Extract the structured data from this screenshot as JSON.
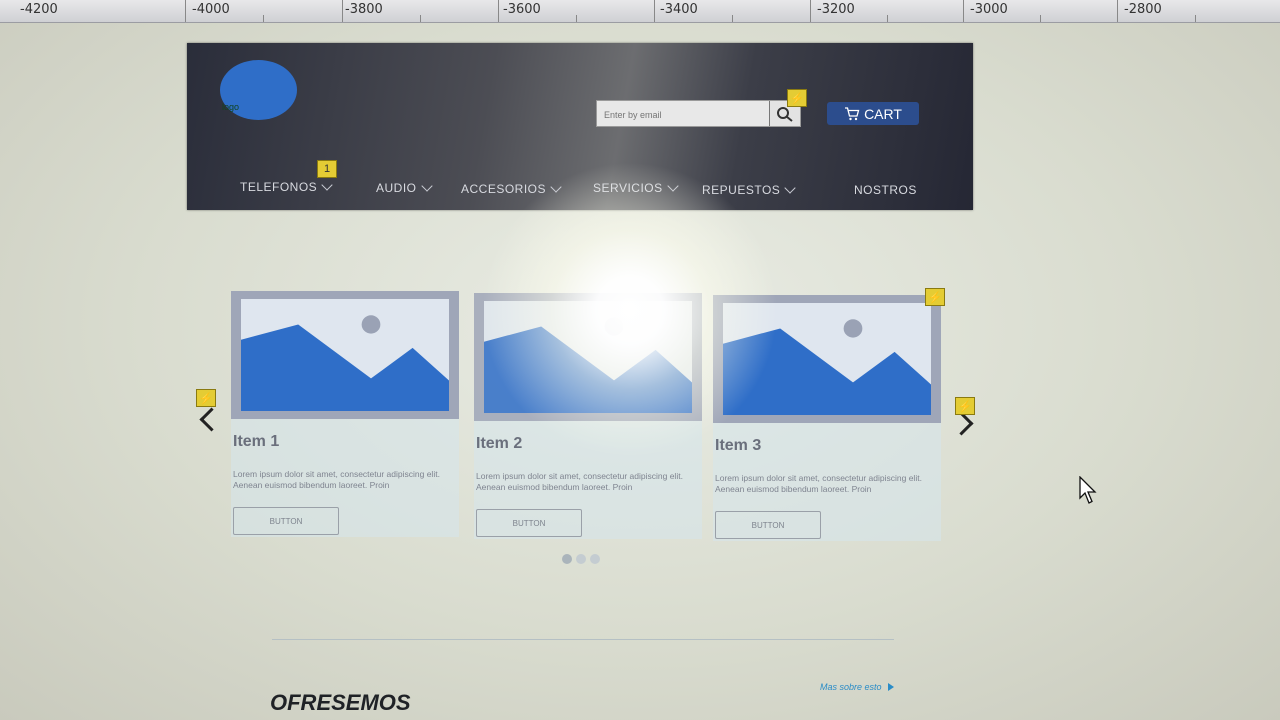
{
  "ruler": {
    "labels": [
      "-4200",
      "-4000",
      "-3800",
      "-3600",
      "-3400",
      "-3200",
      "-3000",
      "-2800"
    ]
  },
  "header": {
    "logo_text": "logo",
    "search_placeholder": "Enter by email",
    "cart_label": "CART",
    "nav": [
      {
        "label": "TELEFONOS",
        "has_dropdown": true
      },
      {
        "label": "AUDIO",
        "has_dropdown": true
      },
      {
        "label": "ACCESORIOS",
        "has_dropdown": true
      },
      {
        "label": "SERVICIOS",
        "has_dropdown": true
      },
      {
        "label": "REPUESTOS",
        "has_dropdown": true
      },
      {
        "label": "NOSTROS",
        "has_dropdown": false
      }
    ],
    "nav_badge": "1"
  },
  "carousel": {
    "items": [
      {
        "title": "Item 1",
        "text": "Lorem ipsum dolor sit amet, consectetur adipiscing elit. Aenean euismod bibendum laoreet. Proin",
        "button": "BUTTON"
      },
      {
        "title": "Item 2",
        "text": "Lorem ipsum dolor sit amet, consectetur adipiscing elit. Aenean euismod bibendum laoreet. Proin",
        "button": "BUTTON"
      },
      {
        "title": "Item 3",
        "text": "Lorem ipsum dolor sit amet, consectetur adipiscing elit. Aenean euismod bibendum laoreet. Proin",
        "button": "BUTTON"
      }
    ],
    "page_count": 3,
    "active_page": 1
  },
  "section": {
    "title": "OFRESEMOS",
    "more_link": "Mas sobre esto"
  },
  "colors": {
    "header_dark": "#2a2d3a",
    "cart_blue": "#2c4d8d",
    "image_blue": "#2f6ec8",
    "badge_yellow": "#e4cc34",
    "link_blue": "#2a8cc7"
  }
}
